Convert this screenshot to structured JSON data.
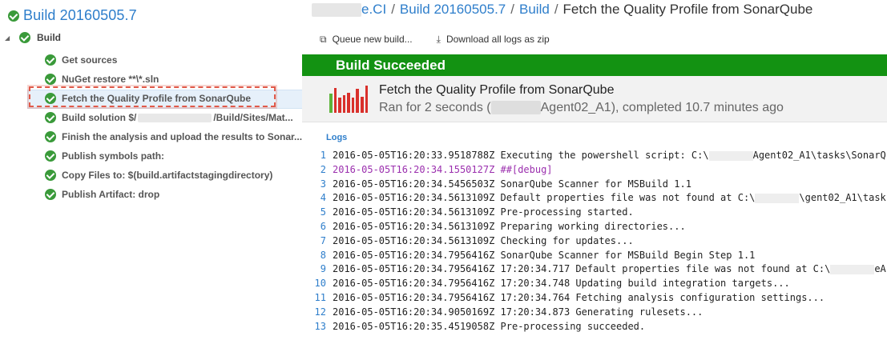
{
  "build": {
    "title": "Build 20160505.7",
    "root_label": "Build",
    "steps": [
      {
        "label": "Get sources"
      },
      {
        "label": "NuGet restore **\\*.sln"
      },
      {
        "label": "Fetch the Quality Profile from SonarQube",
        "selected": true
      },
      {
        "label_pre": "Build solution $/",
        "label_post": "/Build/Sites/Mat..."
      },
      {
        "label": "Finish the analysis and upload the results to Sonar..."
      },
      {
        "label": "Publish symbols path:"
      },
      {
        "label": "Copy Files to: $(build.artifactstagingdirectory)"
      },
      {
        "label": "Publish Artifact: drop"
      }
    ]
  },
  "breadcrumb": {
    "project_suffix": "e.CI",
    "build": "Build 20160505.7",
    "section": "Build",
    "current": "Fetch the Quality Profile from SonarQube",
    "separator": "/"
  },
  "toolbar": {
    "queue_label": "Queue new build...",
    "download_label": "Download all logs as zip"
  },
  "status": {
    "text": "Build Succeeded",
    "color": "#139212"
  },
  "summary": {
    "step_title": "Fetch the Quality Profile from SonarQube",
    "meta_pre": "Ran for 2 seconds (",
    "meta_post": "Agent02_A1), completed 10.7 minutes ago",
    "bars": [
      {
        "level": 0.92,
        "status": "failed"
      },
      {
        "level": 0.55,
        "status": "failed"
      },
      {
        "level": 0.64,
        "status": "failed"
      },
      {
        "level": 0.74,
        "status": "failed"
      },
      {
        "level": 0.56,
        "status": "failed"
      },
      {
        "level": 0.87,
        "status": "failed"
      },
      {
        "level": 0.6,
        "status": "failed"
      },
      {
        "level": 1.0,
        "status": "failed"
      }
    ]
  },
  "logs": {
    "heading": "Logs",
    "lines": [
      {
        "n": "1",
        "text": "2016-05-05T16:20:33.9518788Z Executing the powershell script: C:\\",
        "text_post": "Agent02_A1\\tasks\\SonarQ"
      },
      {
        "n": "2",
        "text": "2016-05-05T16:20:34.1550127Z ##[debug]",
        "debug": true
      },
      {
        "n": "3",
        "text": "2016-05-05T16:20:34.5456503Z SonarQube Scanner for MSBuild 1.1"
      },
      {
        "n": "4",
        "text": "2016-05-05T16:20:34.5613109Z Default properties file was not found at C:\\",
        "text_post": "\\gent02_A1\\task"
      },
      {
        "n": "5",
        "text": "2016-05-05T16:20:34.5613109Z Pre-processing started."
      },
      {
        "n": "6",
        "text": "2016-05-05T16:20:34.5613109Z Preparing working directories..."
      },
      {
        "n": "7",
        "text": "2016-05-05T16:20:34.5613109Z Checking for updates..."
      },
      {
        "n": "8",
        "text": "2016-05-05T16:20:34.7956416Z SonarQube Scanner for MSBuild Begin Step 1.1"
      },
      {
        "n": "9",
        "text": "2016-05-05T16:20:34.7956416Z 17:20:34.717  Default properties file was not found at C:\\",
        "text_post": "eA"
      },
      {
        "n": "10",
        "text": "2016-05-05T16:20:34.7956416Z 17:20:34.748  Updating build integration targets..."
      },
      {
        "n": "11",
        "text": "2016-05-05T16:20:34.7956416Z 17:20:34.764  Fetching analysis configuration settings..."
      },
      {
        "n": "12",
        "text": "2016-05-05T16:20:34.9050169Z 17:20:34.873  Generating rulesets..."
      },
      {
        "n": "13",
        "text": "2016-05-05T16:20:35.4519058Z Pre-processing succeeded."
      }
    ]
  }
}
